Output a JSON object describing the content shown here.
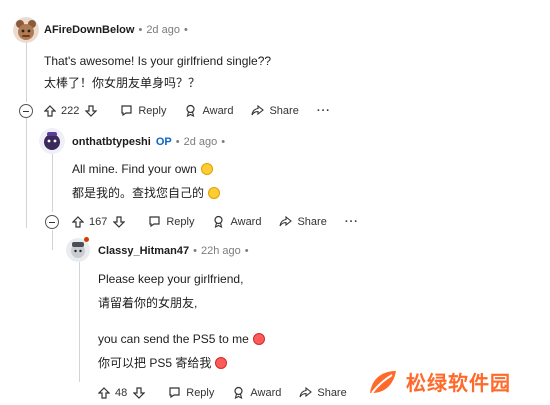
{
  "comments": [
    {
      "username": "AFireDownBelow",
      "time": "2d ago",
      "lines": [
        "That's awesome! Is your girlfriend single??",
        "太棒了！你女朋友单身吗？？"
      ],
      "votes": "222",
      "reply_label": "Reply",
      "award_label": "Award",
      "share_label": "Share"
    },
    {
      "username": "onthatbtypeshi",
      "op_badge": "OP",
      "time": "2d ago",
      "lines": [
        "All mine. Find your own",
        "都是我的。查找您自己的"
      ],
      "votes": "167",
      "reply_label": "Reply",
      "award_label": "Award",
      "share_label": "Share"
    },
    {
      "username": "Classy_Hitman47",
      "time": "22h ago",
      "lines": [
        "Please keep your girlfriend,",
        "请留着你的女朋友,",
        "you can send the PS5 to me",
        "你可以把 PS5 寄给我"
      ],
      "votes": "48",
      "reply_label": "Reply",
      "award_label": "Award",
      "share_label": "Share"
    }
  ],
  "more_icon": "ellipsis-icon",
  "watermark": {
    "text": "松绿软件园",
    "color": "#ff6a2a"
  }
}
